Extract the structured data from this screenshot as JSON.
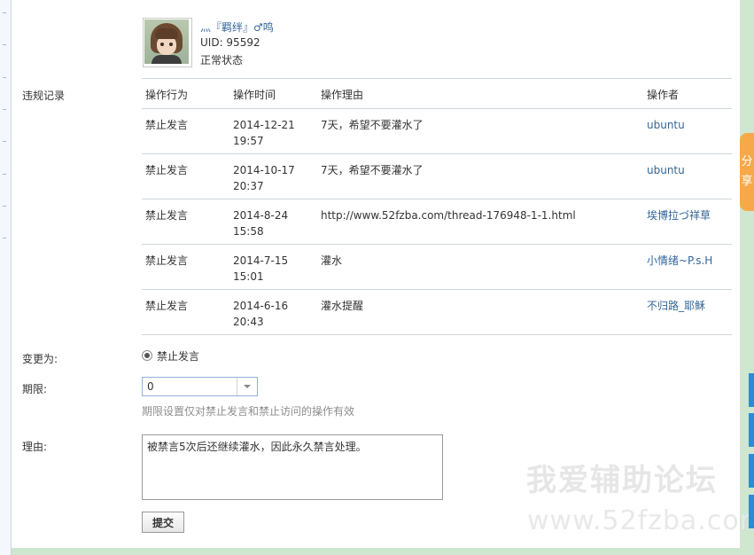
{
  "user": {
    "name": "灬『羁绊』♂鸣",
    "uid": "UID: 95592",
    "status": "正常状态"
  },
  "records": {
    "label": "违规记录",
    "headers": [
      "操作行为",
      "操作时间",
      "操作理由",
      "操作者"
    ],
    "rows": [
      {
        "action": "禁止发言",
        "date": "2014-12-21",
        "time": "19:57",
        "reason": "7天，希望不要灌水了",
        "operator": "ubuntu"
      },
      {
        "action": "禁止发言",
        "date": "2014-10-17",
        "time": "20:37",
        "reason": "7天，希望不要灌水了",
        "operator": "ubuntu"
      },
      {
        "action": "禁止发言",
        "date": "2014-8-24",
        "time": "15:58",
        "reason": "http://www.52fzba.com/thread-176948-1-1.html",
        "operator": "埃博拉づ祥草"
      },
      {
        "action": "禁止发言",
        "date": "2014-7-15",
        "time": "15:01",
        "reason": "灌水",
        "operator": "小情绪~P.s.H"
      },
      {
        "action": "禁止发言",
        "date": "2014-6-16",
        "time": "20:43",
        "reason": "灌水提醒",
        "operator": "不归路_耶稣"
      }
    ]
  },
  "change": {
    "label": "变更为:",
    "option": "禁止发言",
    "selected": true
  },
  "term": {
    "label": "期限:",
    "value": "0",
    "hint": "期限设置仅对禁止发言和禁止访问的操作有效"
  },
  "reason": {
    "label": "理由:",
    "value": "被禁言5次后还继续灌水，因此永久禁言处理。"
  },
  "submit_label": "提交",
  "watermark": {
    "line1": "我爱辅助论坛",
    "line2": "www.52fzba.com"
  },
  "share": {
    "chars": [
      "分",
      "享"
    ]
  },
  "colors": {
    "link": "#336699",
    "share_tab": "#f7a94a",
    "side_button": "#2a8cd8",
    "page_bg": "#cfe6cf"
  }
}
